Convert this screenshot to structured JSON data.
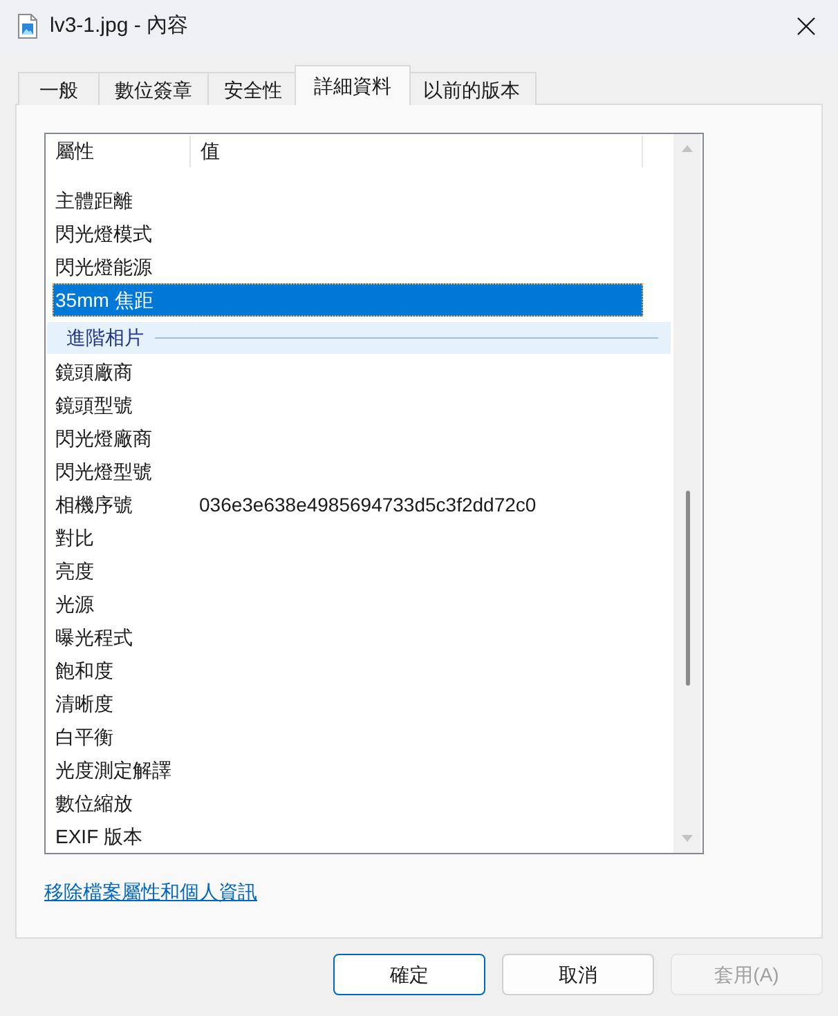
{
  "window": {
    "title": "lv3-1.jpg - 內容"
  },
  "tabs": [
    {
      "label": "一般",
      "selected": false
    },
    {
      "label": "數位簽章",
      "selected": false
    },
    {
      "label": "安全性",
      "selected": false
    },
    {
      "label": "詳細資料",
      "selected": true
    },
    {
      "label": "以前的版本",
      "selected": false
    }
  ],
  "details": {
    "columns": [
      "屬性",
      "值"
    ],
    "rows": [
      {
        "kind": "property",
        "name": "主體距離",
        "selected": false
      },
      {
        "kind": "property",
        "name": "閃光燈模式",
        "selected": false
      },
      {
        "kind": "property",
        "name": "閃光燈能源",
        "selected": false
      },
      {
        "kind": "property",
        "name": "35mm 焦距",
        "selected": true
      },
      {
        "kind": "group",
        "label": "進階相片"
      },
      {
        "kind": "property",
        "name": "鏡頭廠商",
        "selected": false
      },
      {
        "kind": "property",
        "name": "鏡頭型號",
        "selected": false
      },
      {
        "kind": "property",
        "name": "閃光燈廠商",
        "selected": false
      },
      {
        "kind": "property",
        "name": "閃光燈型號",
        "selected": false
      },
      {
        "kind": "property",
        "name": "相機序號",
        "value": "036e3e638e4985694733d5c3f2dd72c0",
        "selected": false
      },
      {
        "kind": "property",
        "name": "對比",
        "selected": false
      },
      {
        "kind": "property",
        "name": "亮度",
        "selected": false
      },
      {
        "kind": "property",
        "name": "光源",
        "selected": false
      },
      {
        "kind": "property",
        "name": "曝光程式",
        "selected": false
      },
      {
        "kind": "property",
        "name": "飽和度",
        "selected": false
      },
      {
        "kind": "property",
        "name": "清晰度",
        "selected": false
      },
      {
        "kind": "property",
        "name": "白平衡",
        "selected": false
      },
      {
        "kind": "property",
        "name": "光度測定解譯",
        "selected": false
      },
      {
        "kind": "property",
        "name": "數位縮放",
        "selected": false
      },
      {
        "kind": "property",
        "name": "EXIF 版本",
        "selected": false
      }
    ]
  },
  "remove_link": "移除檔案屬性和個人資訊",
  "buttons": [
    {
      "label": "確定",
      "default": true,
      "disabled": false
    },
    {
      "label": "取消",
      "default": false,
      "disabled": false
    },
    {
      "label": "套用(A)",
      "default": false,
      "disabled": true
    }
  ]
}
